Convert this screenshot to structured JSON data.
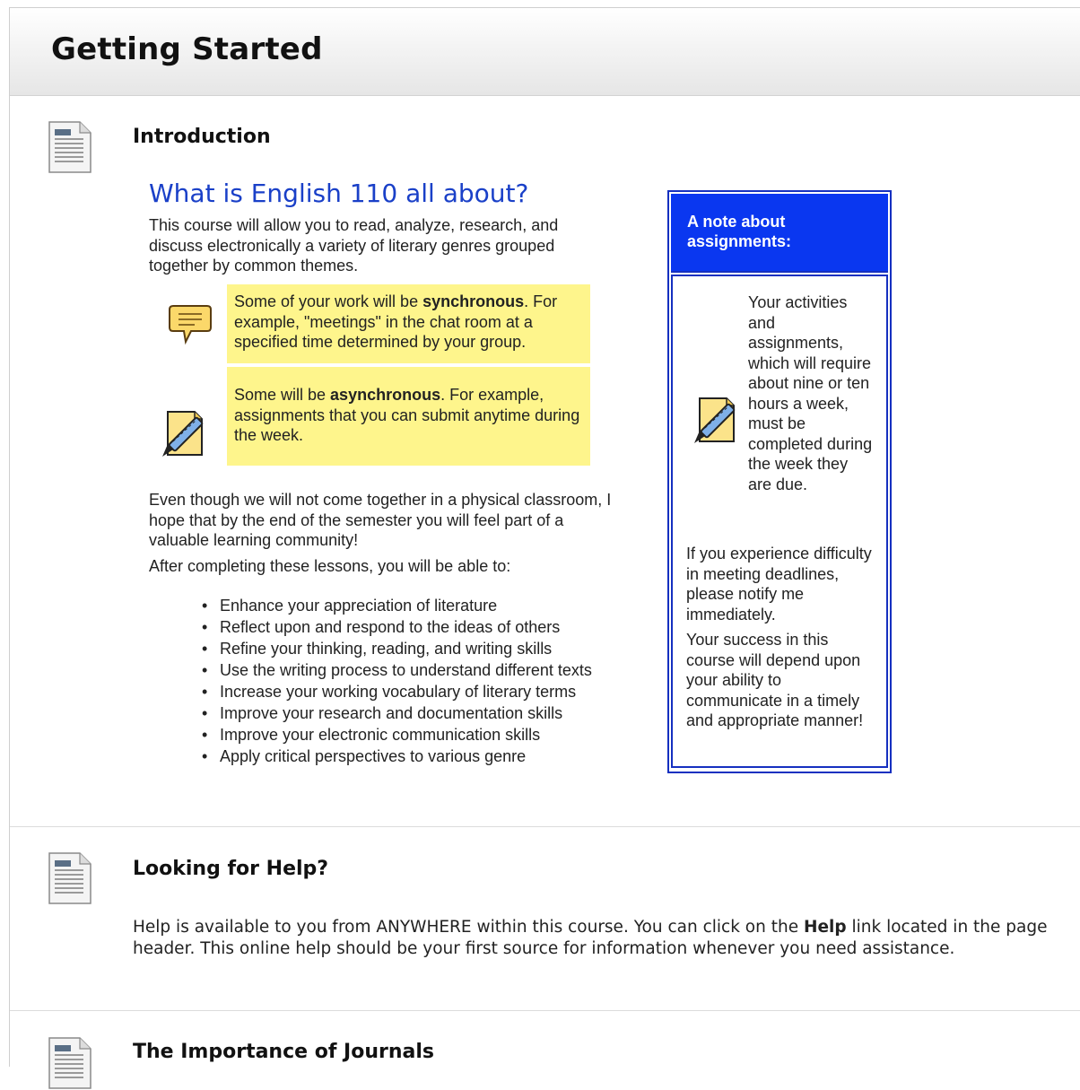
{
  "page": {
    "title": "Getting Started"
  },
  "items": [
    {
      "title": "Introduction",
      "icon": "document-icon",
      "body": {
        "heading": "What is English 110 all about?",
        "intro": "This course will allow you to read, analyze, research, and discuss electronically a variety of literary genres grouped together by common themes.",
        "sync": {
          "pre": "Some of your work will be ",
          "bold": "synchronous",
          "post": ". For example, \"meetings\" in the chat room at a specified time determined by your group.",
          "icon": "chat-bubble-icon"
        },
        "async": {
          "pre": "Some will be ",
          "bold": "asynchronous",
          "post": ". For example, assignments that you can submit anytime during the week.",
          "icon": "assignment-icon"
        },
        "community": "Even though we will not come together in a physical classroom, I hope that by the end of the semester you will feel part of a valuable learning community!",
        "after": "After completing these lessons, you will be able to:",
        "outcomes": [
          "Enhance your appreciation of literature",
          "Reflect upon and respond to the ideas of others",
          "Refine your thinking, reading, and writing skills",
          "Use the writing process to understand different texts",
          "Increase your working vocabulary of literary terms",
          "Improve your research and documentation skills",
          "Improve your electronic communication skills",
          "Apply critical perspectives to various genre"
        ],
        "note": {
          "title": "A note about assignments:",
          "workload": "Your activities and assignments, which will require about nine or ten hours a week, must be completed during the week they are due.",
          "difficulty": "If you experience difficulty in meeting deadlines, please notify me immediately.",
          "success": "Your success in this course will depend upon your ability to communicate in a timely and appropriate manner!"
        }
      }
    },
    {
      "title": "Looking for Help?",
      "icon": "document-icon",
      "help": {
        "t1": "Help is available to you from ANYWHERE within this course. You can click on the ",
        "bold": "Help",
        "t2": " link located in the page header. This online help should be your first source for information whenever you need assistance."
      }
    },
    {
      "title": "The Importance of Journals",
      "icon": "document-icon"
    }
  ],
  "colors": {
    "heading_blue": "#1a40c8",
    "note_blue": "#0a37f0",
    "highlight_yellow": "#fef58c"
  }
}
